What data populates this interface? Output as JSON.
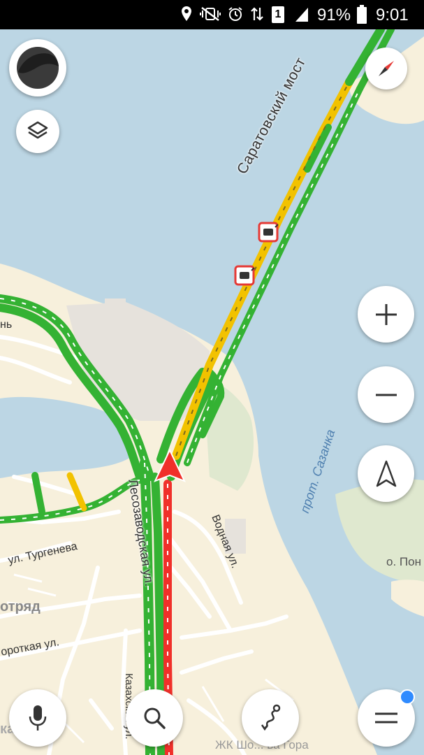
{
  "status_bar": {
    "battery_percent": "91%",
    "time": "9:01",
    "sim_slot": "1",
    "icons": [
      "location-icon",
      "vibrate-mute-icon",
      "alarm-icon",
      "data-transfer-icon",
      "sim-card-icon",
      "signal-icon",
      "battery-icon"
    ]
  },
  "map": {
    "labels": {
      "bridge": "Саратовский мост",
      "street_main": "Лесозаводская ул.",
      "street_vodnaya": "Водная ул.",
      "channel": "прот. Сазанка",
      "island": "о. Пон",
      "street_turgeneva": "ул. Тургенева",
      "street_prefix": "ул.",
      "district_otryad": "отряд",
      "street_korotkaya": "ороткая ул.",
      "street_kazakhskaya": "Казахская ул.",
      "residential_complex": "ЖК Шо... ва Гора",
      "partial_left_top": "нь",
      "partial_left_bottom": "ка"
    },
    "colors": {
      "water": "#bcd6e4",
      "land": "#f7f0dc",
      "traffic_green": "#34b233",
      "traffic_yellow": "#f2c200",
      "traffic_red": "#f0302a"
    }
  },
  "controls": {
    "profile_avatar": "avatar",
    "layers": "layers-icon",
    "compass": "compass-icon",
    "zoom_in": "plus-icon",
    "zoom_out": "minus-icon",
    "my_location": "navigation-arrow-icon",
    "voice": "microphone-icon",
    "search": "search-icon",
    "routes": "route-icon",
    "menu": "menu-icon"
  }
}
